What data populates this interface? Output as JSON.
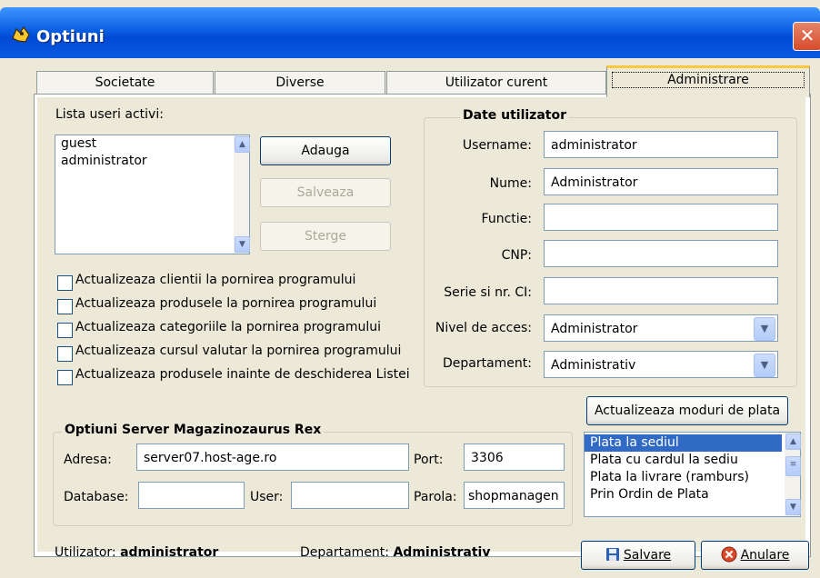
{
  "window": {
    "title": "Optiuni",
    "close_label": "✕"
  },
  "tabs": [
    "Societate",
    "Diverse",
    "Utilizator curent",
    "Administrare"
  ],
  "users": {
    "label": "Lista useri activi:",
    "items": [
      "guest",
      "administrator"
    ],
    "add_label": "Adauga",
    "save_label": "Salveaza",
    "delete_label": "Sterge"
  },
  "checkboxes": [
    "Actualizeaza clientii la pornirea programului",
    "Actualizeaza produsele la pornirea programului",
    "Actualizeaza categoriile la pornirea programului",
    "Actualizeaza cursul valutar la pornirea programului",
    "Actualizeaza produsele inainte de deschiderea Listei"
  ],
  "user_data": {
    "title": "Date utilizator",
    "username_label": "Username:",
    "username": "administrator",
    "name_label": "Nume:",
    "name": "Administrator",
    "function_label": "Functie:",
    "function": "",
    "cnp_label": "CNP:",
    "cnp": "",
    "ci_label": "Serie si nr. CI:",
    "ci": "",
    "access_label": "Nivel de acces:",
    "access": "Administrator",
    "dept_label": "Departament:",
    "dept": "Administrativ"
  },
  "payment": {
    "update_label": "Actualizeaza moduri de plata",
    "items": [
      "Plata la sediul",
      "Plata cu cardul la sediu",
      "Plata la livrare (ramburs)",
      "Prin Ordin de Plata"
    ]
  },
  "server": {
    "title": "Optiuni Server Magazinozaurus Rex",
    "address_label": "Adresa:",
    "address": "server07.host-age.ro",
    "port_label": "Port:",
    "port": "3306",
    "db_label": "Database:",
    "db": "",
    "user_label": "User:",
    "user": "",
    "pass_label": "Parola:",
    "pass": "shopmanagen"
  },
  "status": {
    "user_label": "Utilizator:",
    "user": "administrator",
    "dept_label": "Departament:",
    "dept": "Administrativ"
  },
  "actions": {
    "save_label": "Salvare",
    "cancel_label": "Anulare"
  },
  "colors": {
    "accent": "#316ac5",
    "titlebar": "#0a5fe0",
    "tab_highlight": "#ffc83c"
  }
}
